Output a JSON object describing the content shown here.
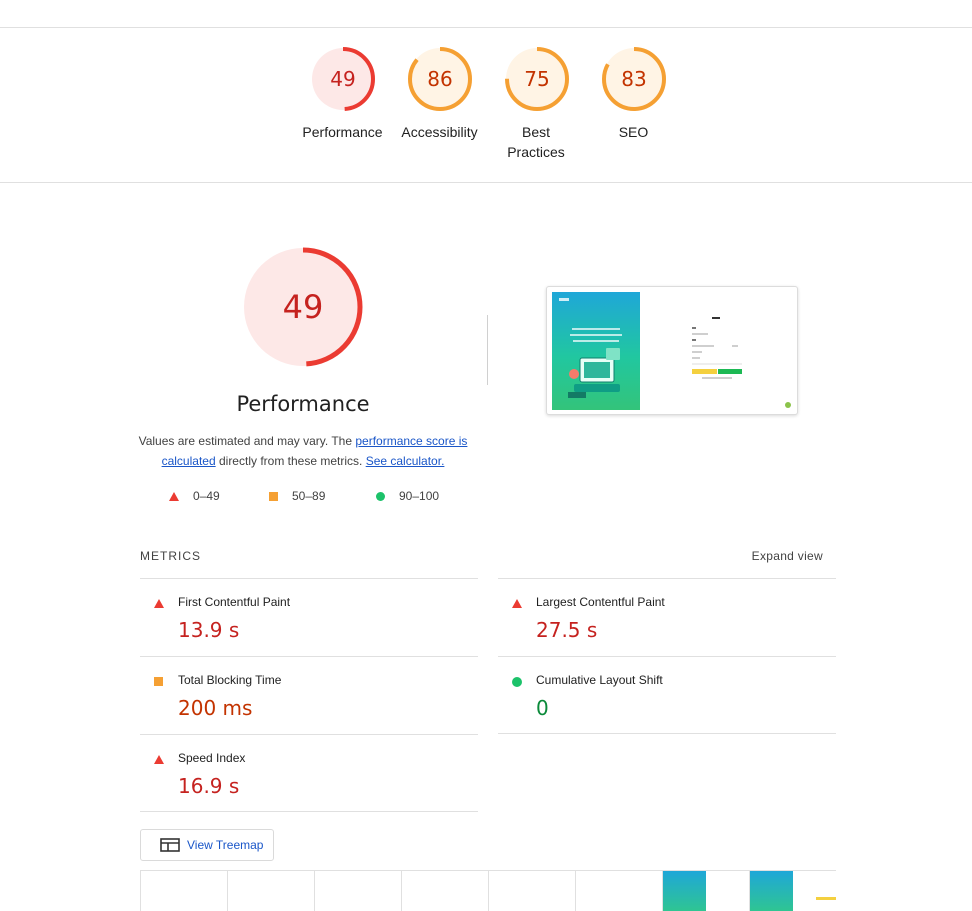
{
  "categories": [
    {
      "label": "Performance",
      "score": "49",
      "value": 49,
      "color": "#eb3b32",
      "bg": "#fde8e7",
      "text_color": "#c5221f"
    },
    {
      "label": "Accessibility",
      "score": "86",
      "value": 86,
      "color": "#f5a033",
      "bg": "#fff4e5",
      "text_color": "#c33300"
    },
    {
      "label": "Best Practices",
      "score": "75",
      "value": 75,
      "color": "#f5a033",
      "bg": "#fff4e5",
      "text_color": "#c33300"
    },
    {
      "label": "SEO",
      "score": "83",
      "value": 83,
      "color": "#f5a033",
      "bg": "#fff4e5",
      "text_color": "#c33300"
    }
  ],
  "performance": {
    "score": "49",
    "value": 49,
    "title": "Performance",
    "desc_prefix": "Values are estimated and may vary. The ",
    "link1": "performance score is calculated",
    "desc_mid": " directly from these metrics. ",
    "link2": "See calculator."
  },
  "legend": {
    "fail": "0–49",
    "average": "50–89",
    "pass": "90–100"
  },
  "metrics": {
    "title": "METRICS",
    "expand": "Expand view",
    "items": [
      {
        "name": "First Contentful Paint",
        "value": "13.9 s",
        "status": "fail",
        "color": "#c5221f"
      },
      {
        "name": "Largest Contentful Paint",
        "value": "27.5 s",
        "status": "fail",
        "color": "#c5221f"
      },
      {
        "name": "Total Blocking Time",
        "value": "200 ms",
        "status": "average",
        "color": "#c33300"
      },
      {
        "name": "Cumulative Layout Shift",
        "value": "0",
        "status": "pass",
        "color": "#0b8a3a"
      },
      {
        "name": "Speed Index",
        "value": "16.9 s",
        "status": "fail",
        "color": "#c5221f"
      }
    ]
  },
  "treemap": {
    "label": "View Treemap"
  }
}
